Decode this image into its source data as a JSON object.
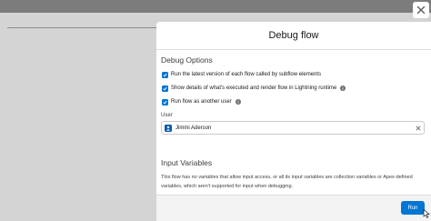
{
  "modal": {
    "title": "Debug flow"
  },
  "debug_options": {
    "title": "Debug Options",
    "options": [
      {
        "label": "Run the latest version of each flow called by subflow elements",
        "checked": true,
        "has_info": false
      },
      {
        "label": "Show details of what's executed and render flow in Lightning runtime",
        "checked": true,
        "has_info": true
      },
      {
        "label": "Run flow as another user",
        "checked": true,
        "has_info": true
      }
    ]
  },
  "user": {
    "label": "User",
    "value": "Jimmi Aderson",
    "avatar_icon": "user-icon",
    "clear_icon": "close-icon"
  },
  "input_variables": {
    "title": "Input Variables",
    "description": "This flow has no variables that allow input access, or all its input variables are collection variables or Apex-defined variables, which aren't supported for input when debugging."
  },
  "footer": {
    "run_label": "Run"
  },
  "colors": {
    "brand": "#0176d3",
    "overlay": "#7c7c7c"
  }
}
